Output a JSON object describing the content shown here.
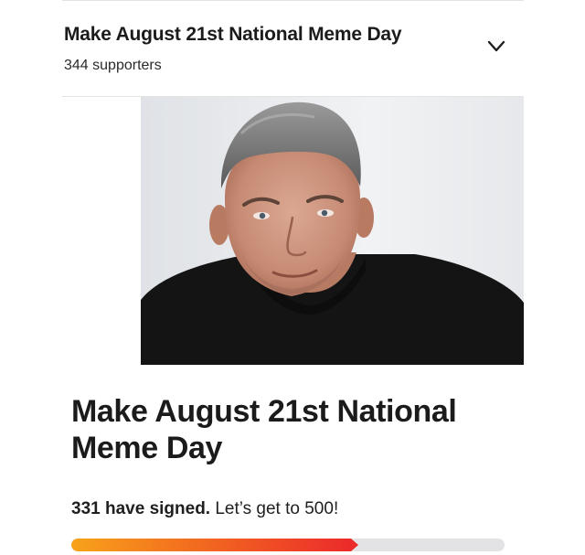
{
  "header": {
    "title": "Make August 21st National Meme Day",
    "supporters": "344 supporters",
    "toggle_icon": "chevron-down-icon"
  },
  "petition": {
    "title": "Make August 21st National Meme Day",
    "signed_count_text": "331 have signed.",
    "goal_text": " Let’s get to 500!",
    "signed": 331,
    "goal": 500,
    "progress_fraction": 0.662
  },
  "colors": {
    "progress_start": "#f7a21b",
    "progress_end": "#ec2b2b",
    "track": "#e3e3e6"
  }
}
